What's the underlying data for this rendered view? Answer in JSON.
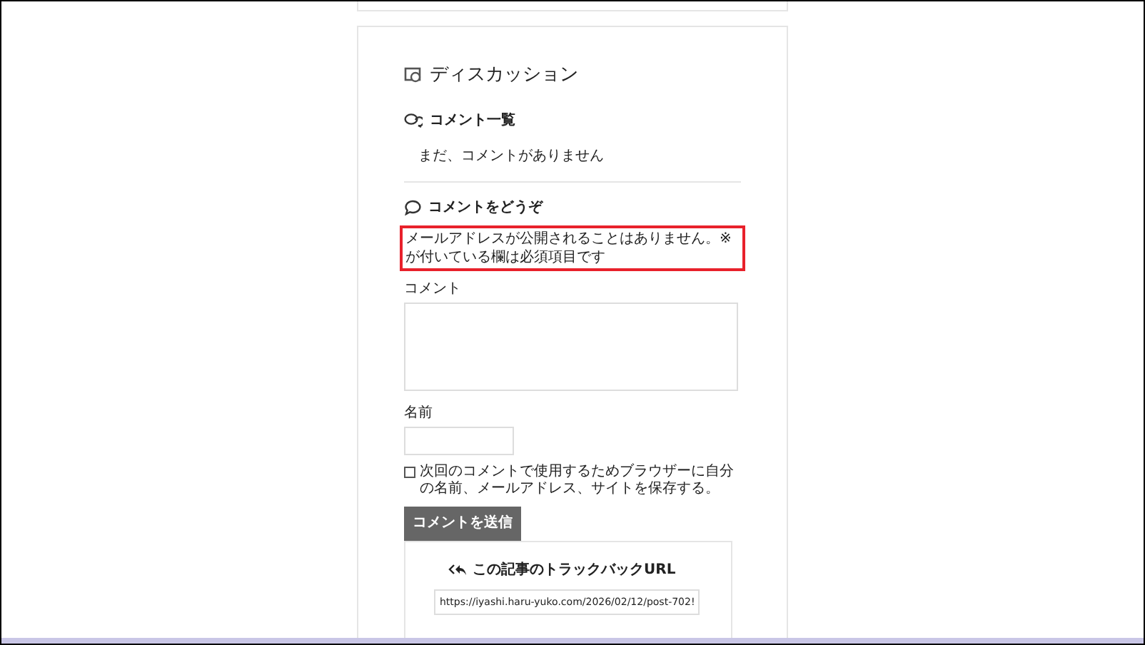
{
  "discussion": {
    "title": "ディスカッション"
  },
  "comment_list": {
    "title": "コメント一覧",
    "empty_message": "まだ、コメントがありません"
  },
  "comment_form": {
    "title": "コメントをどうぞ",
    "notice": "メールアドレスが公開されることはありません。※ が付いている欄は必須項目です",
    "notice_highlighted": true,
    "comment_label": "コメント",
    "name_label": "名前",
    "save_info": {
      "label": "次回のコメントで使用するためブラウザーに自分の名前、メールアドレス、サイトを保存する。",
      "checked": false
    },
    "submit_button": "コメントを送信"
  },
  "trackback": {
    "title": "この記事のトラックバックURL",
    "url": "https://iyashi.haru-yuko.com/2026/02/12/post-702!"
  }
}
